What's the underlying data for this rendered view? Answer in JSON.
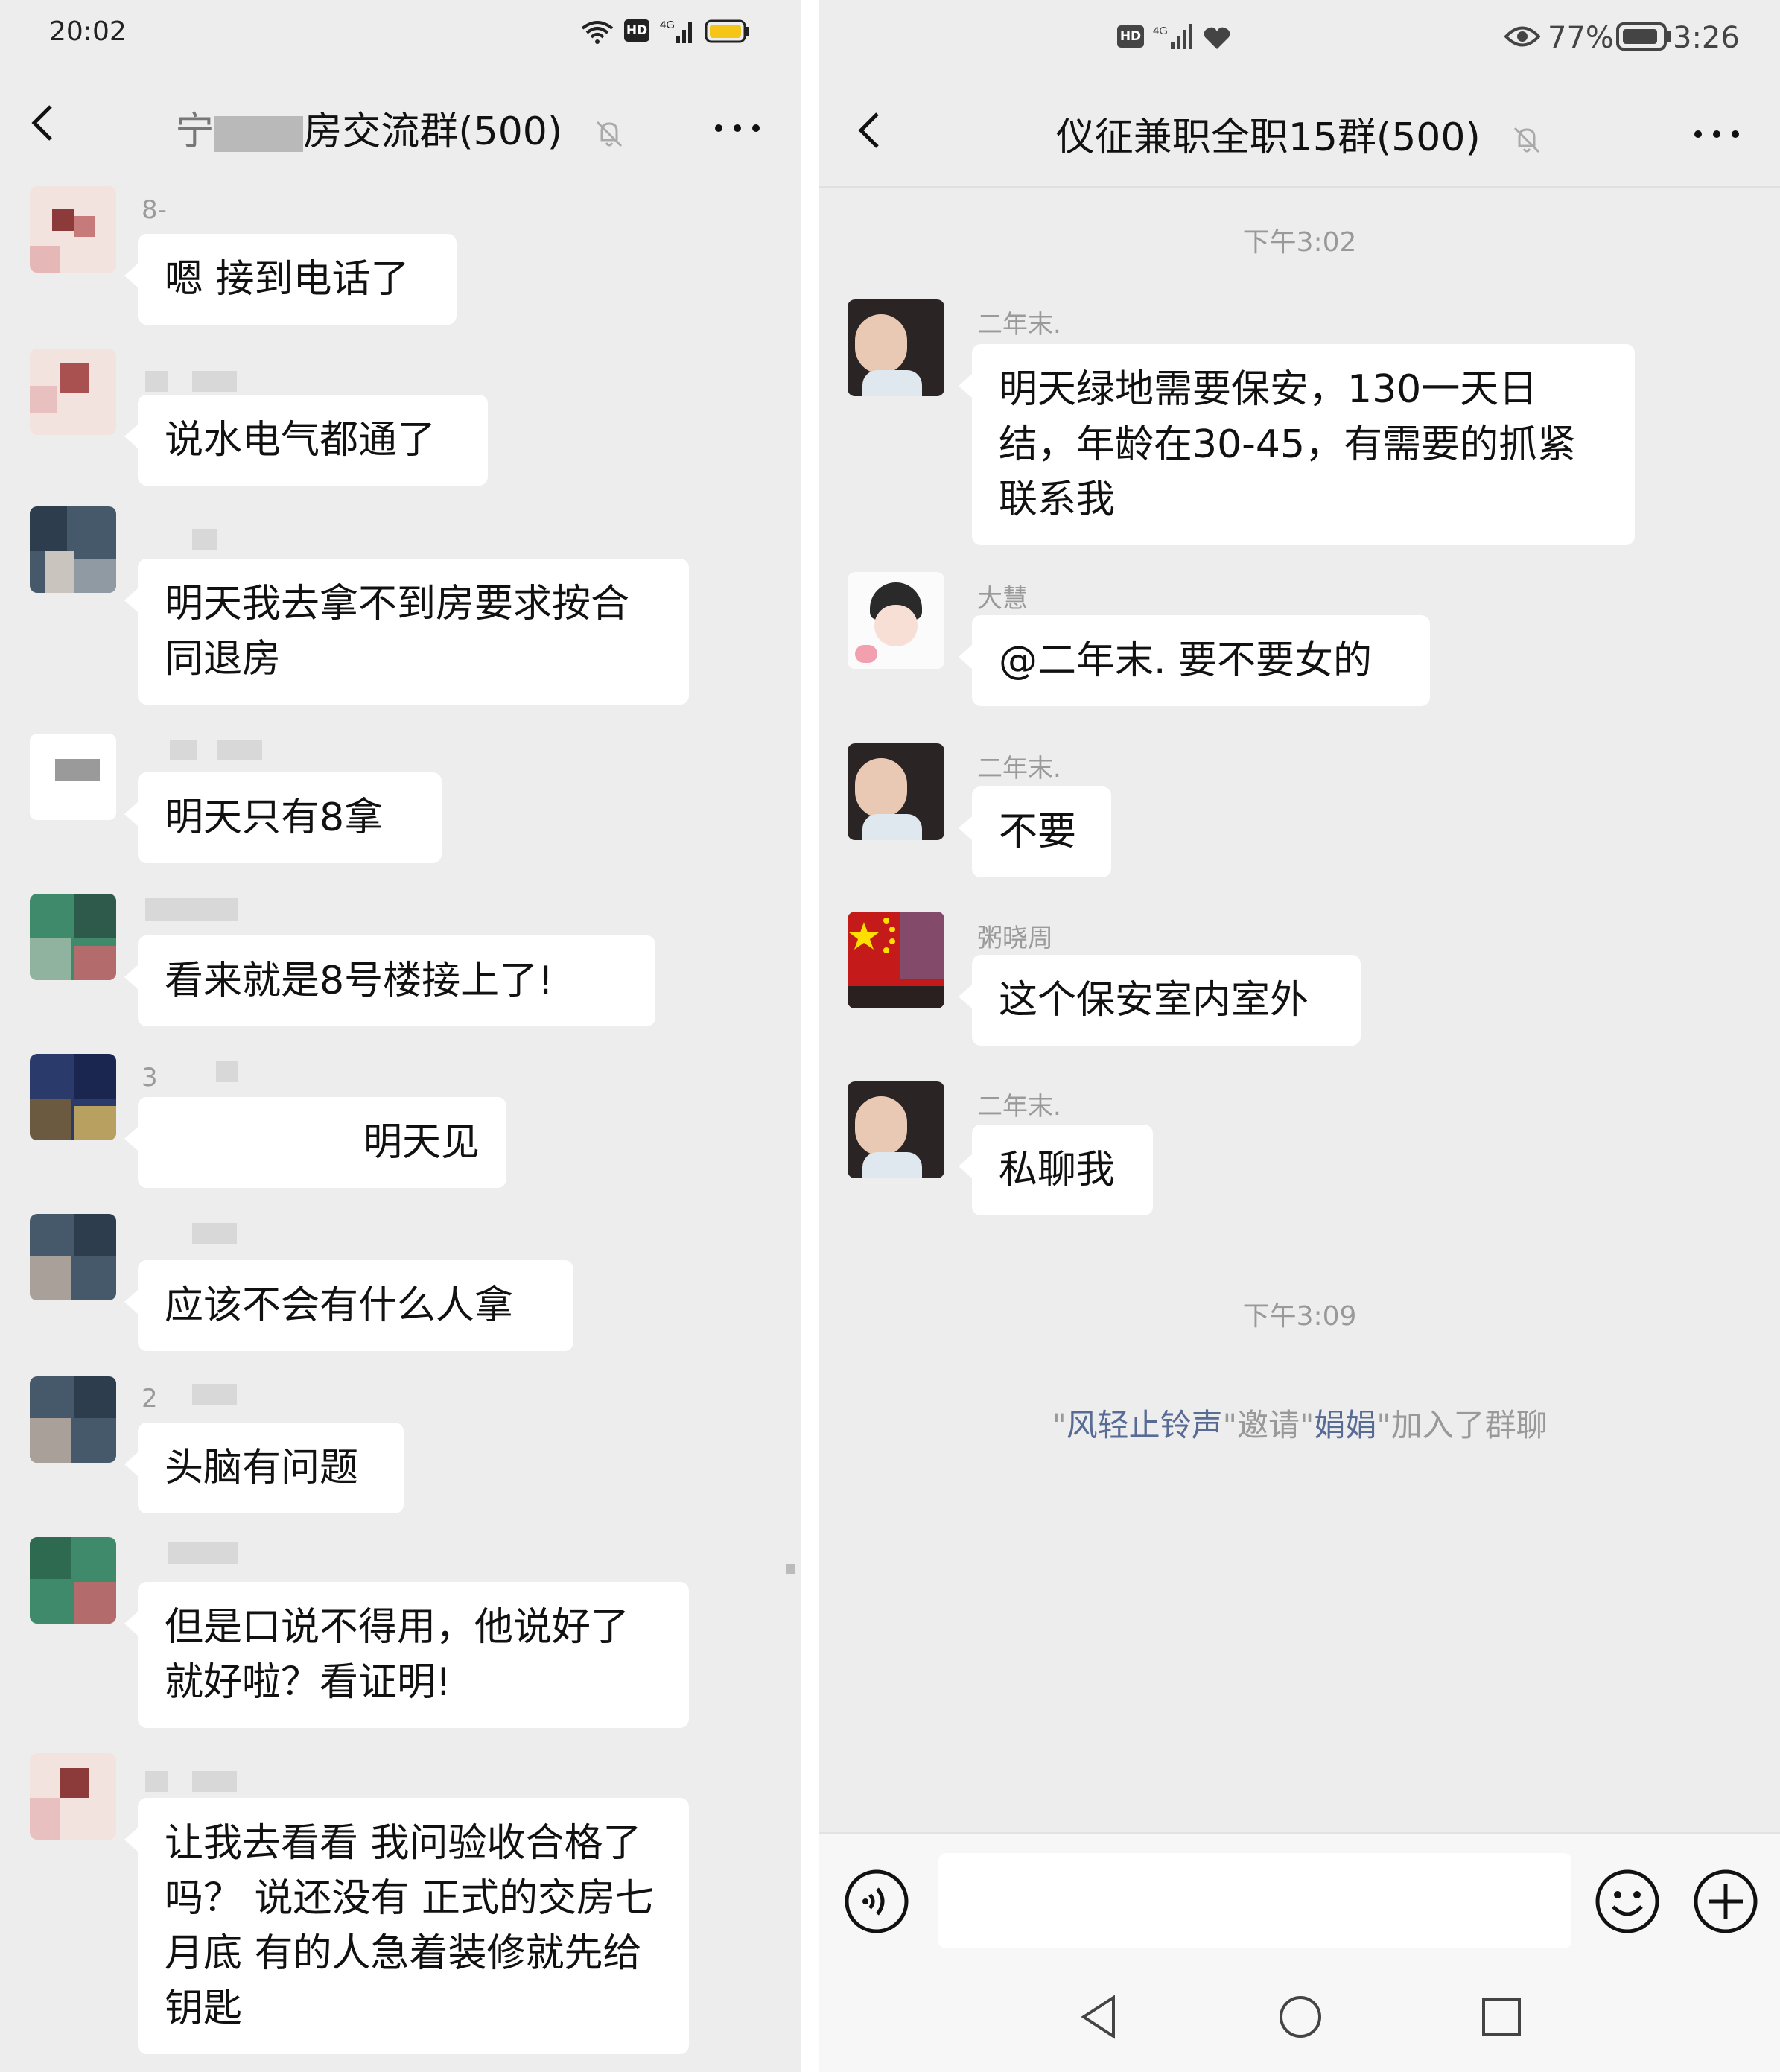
{
  "left": {
    "status": {
      "time": "20:02",
      "hd": "HD",
      "signal": "4G"
    },
    "title": "房交流群(500)",
    "title_prefix_visible": "宁",
    "messages": [
      {
        "name": "8-",
        "text": "嗯 接到电话了"
      },
      {
        "name": "",
        "text": "说水电气都通了"
      },
      {
        "name": "",
        "text": "明天我去拿不到房要求按合同退房"
      },
      {
        "name": "",
        "text": "明天只有8拿"
      },
      {
        "name": "",
        "text": "看来就是8号楼接上了!"
      },
      {
        "name": "3",
        "text": "明天见"
      },
      {
        "name": "",
        "text": "应该不会有什么人拿"
      },
      {
        "name": "2",
        "text": "头脑有问题"
      },
      {
        "name": "",
        "text": "但是口说不得用，他说好了就好啦？看证明!"
      },
      {
        "name": "",
        "text": "让我去看看 我问验收合格了吗？ 说还没有 正式的交房七月底 有的人急着装修就先给钥匙"
      }
    ]
  },
  "right": {
    "status": {
      "hd": "HD",
      "signal": "4G",
      "battery": "77%",
      "time": "3:26"
    },
    "title": "仪征兼职全职15群(500)",
    "time_1": "下午3:02",
    "messages": [
      {
        "name": "二年末.",
        "text": "明天绿地需要保安，130一天日结，年龄在30-45，有需要的抓紧联系我"
      },
      {
        "name": "大慧",
        "text": "@二年末. 要不要女的"
      },
      {
        "name": "二年末.",
        "text": "不要"
      },
      {
        "name": "粥晓周",
        "text": "这个保安室内室外"
      },
      {
        "name": "二年末.",
        "text": "私聊我"
      }
    ],
    "time_2": "下午3:09",
    "system": {
      "q1": "\"",
      "inviter": "风轻止铃声",
      "mid": "\"邀请\"",
      "invitee": "娟娟",
      "end": "\"加入了群聊"
    },
    "colors": {
      "link": "#576b95",
      "bg": "#ededed",
      "bubble": "#ffffff"
    }
  }
}
